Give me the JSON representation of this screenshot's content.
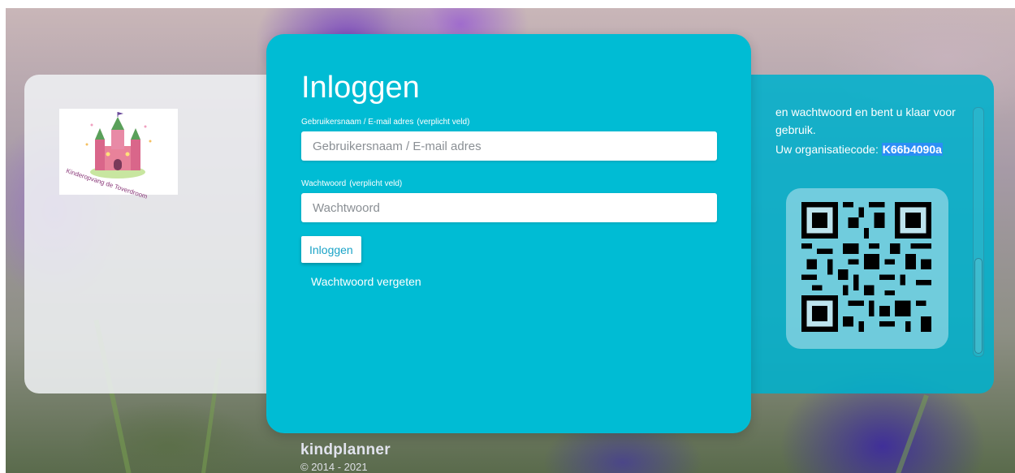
{
  "login": {
    "title": "Inloggen",
    "username_label": "Gebruikersnaam / E-mail adres",
    "username_required": "(verplicht veld)",
    "username_placeholder": "Gebruikersnaam / E-mail adres",
    "password_label": "Wachtwoord",
    "password_required": "(verplicht veld)",
    "password_placeholder": "Wachtwoord",
    "submit_label": "Inloggen",
    "forgot_label": "Wachtwoord vergeten"
  },
  "organization": {
    "logo_caption": "Kinderopvang de Toverdroom"
  },
  "info_panel": {
    "text_line": "en wachtwoord en bent u klaar voor gebruik.",
    "code_prefix": "Uw organisatiecode:",
    "code_value": "K66b4090a"
  },
  "footer": {
    "brand": "kindplanner",
    "copyright": "© 2014 - 2021"
  },
  "colors": {
    "primary": "#00bcd4",
    "code_highlight": "#2b8ef5",
    "button_text": "#1aa3c7"
  },
  "icons": {
    "logo": "castle-logo",
    "qr": "qr-code-icon"
  }
}
